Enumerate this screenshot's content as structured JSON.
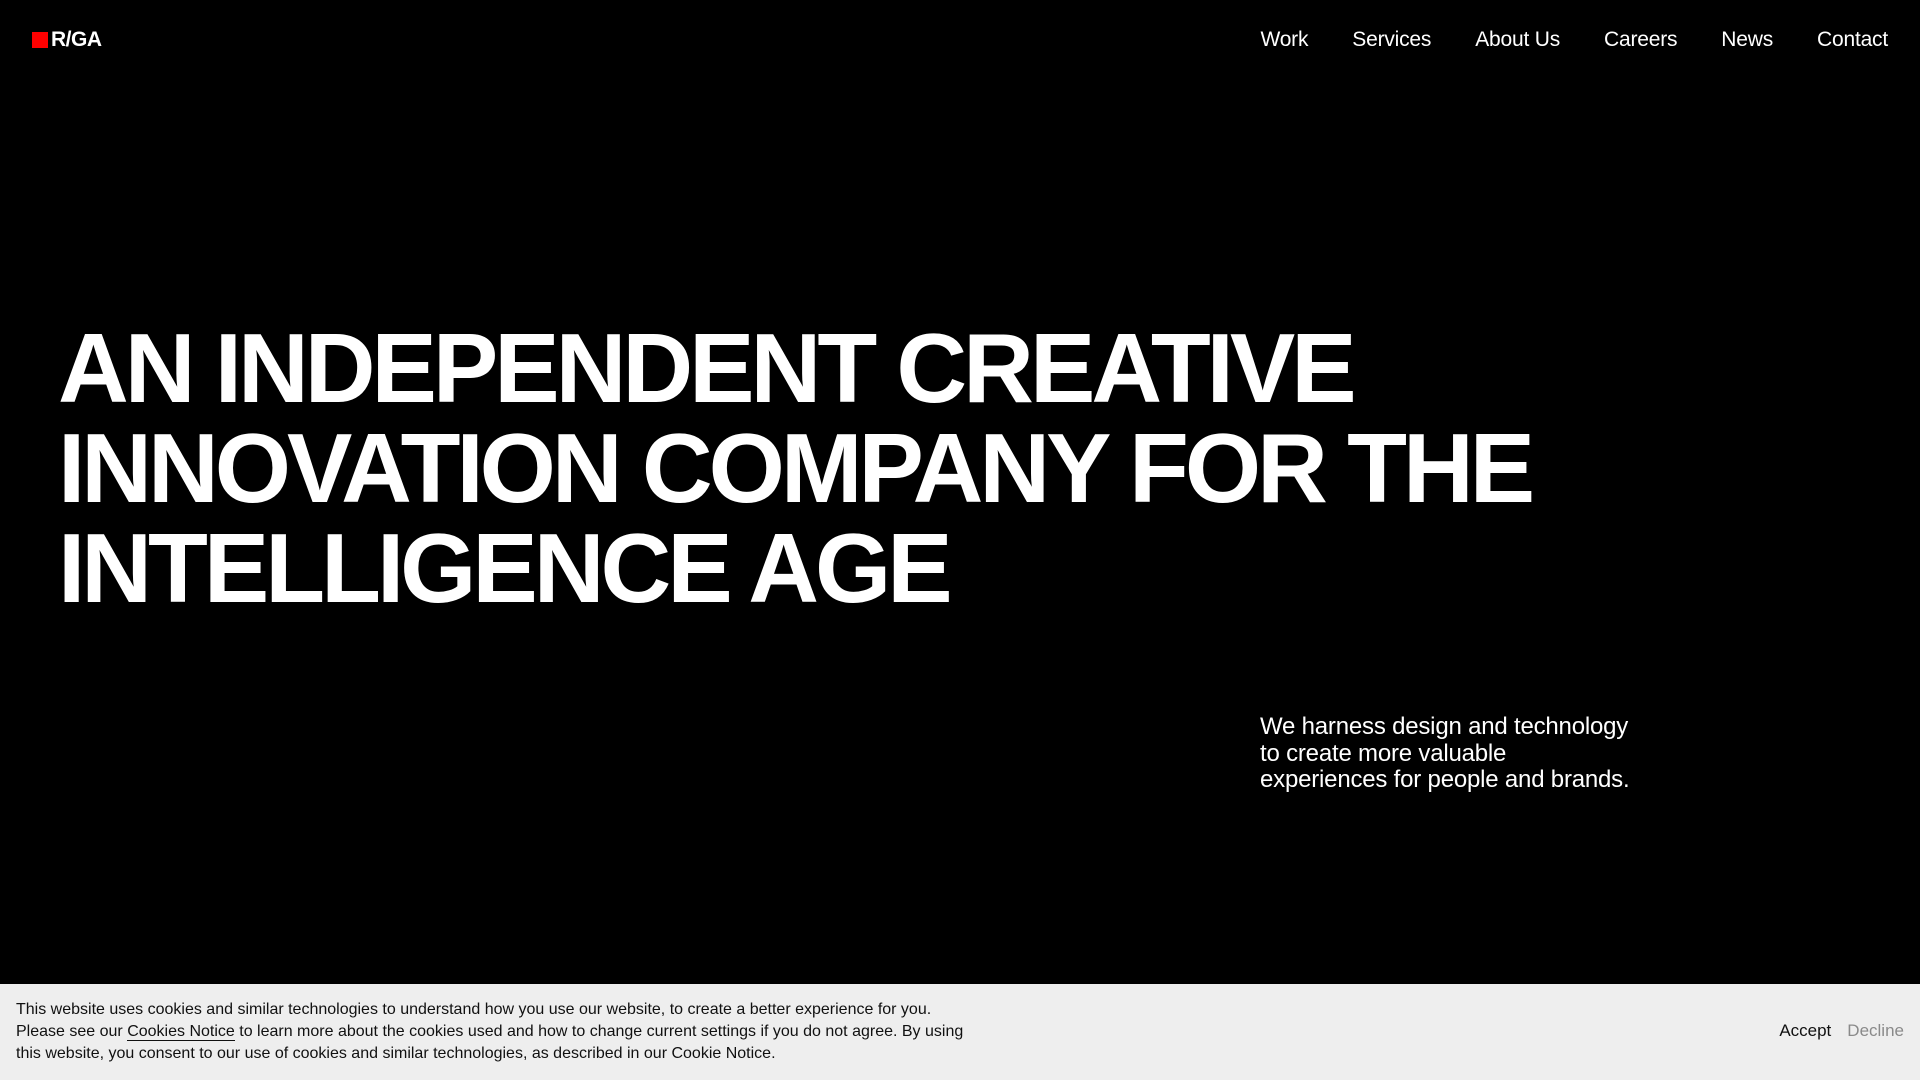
{
  "header": {
    "logo_text": "R/GA",
    "brand_color": "#ff0000",
    "nav": [
      {
        "label": "Work"
      },
      {
        "label": "Services"
      },
      {
        "label": "About Us"
      },
      {
        "label": "Careers"
      },
      {
        "label": "News"
      },
      {
        "label": "Contact"
      }
    ]
  },
  "hero": {
    "title_lines": [
      "AN INDEPENDENT CREATIVE",
      "INNOVATION COMPANY FOR THE",
      "INTELLIGENCE AGE"
    ],
    "subtitle": "We harness design and technology to create more valuable experiences for people and brands."
  },
  "cookie_banner": {
    "text_before_link": "This website uses cookies and similar technologies to understand how you use our website, to create a better experience for you. Please see our ",
    "link_label": "Cookies Notice",
    "text_after_link": " to learn more about the cookies used and how to change current settings if you do not agree. By using this website, you consent to our use of cookies and similar technologies, as described in our Cookie Notice.",
    "accept_label": "Accept",
    "decline_label": "Decline"
  }
}
